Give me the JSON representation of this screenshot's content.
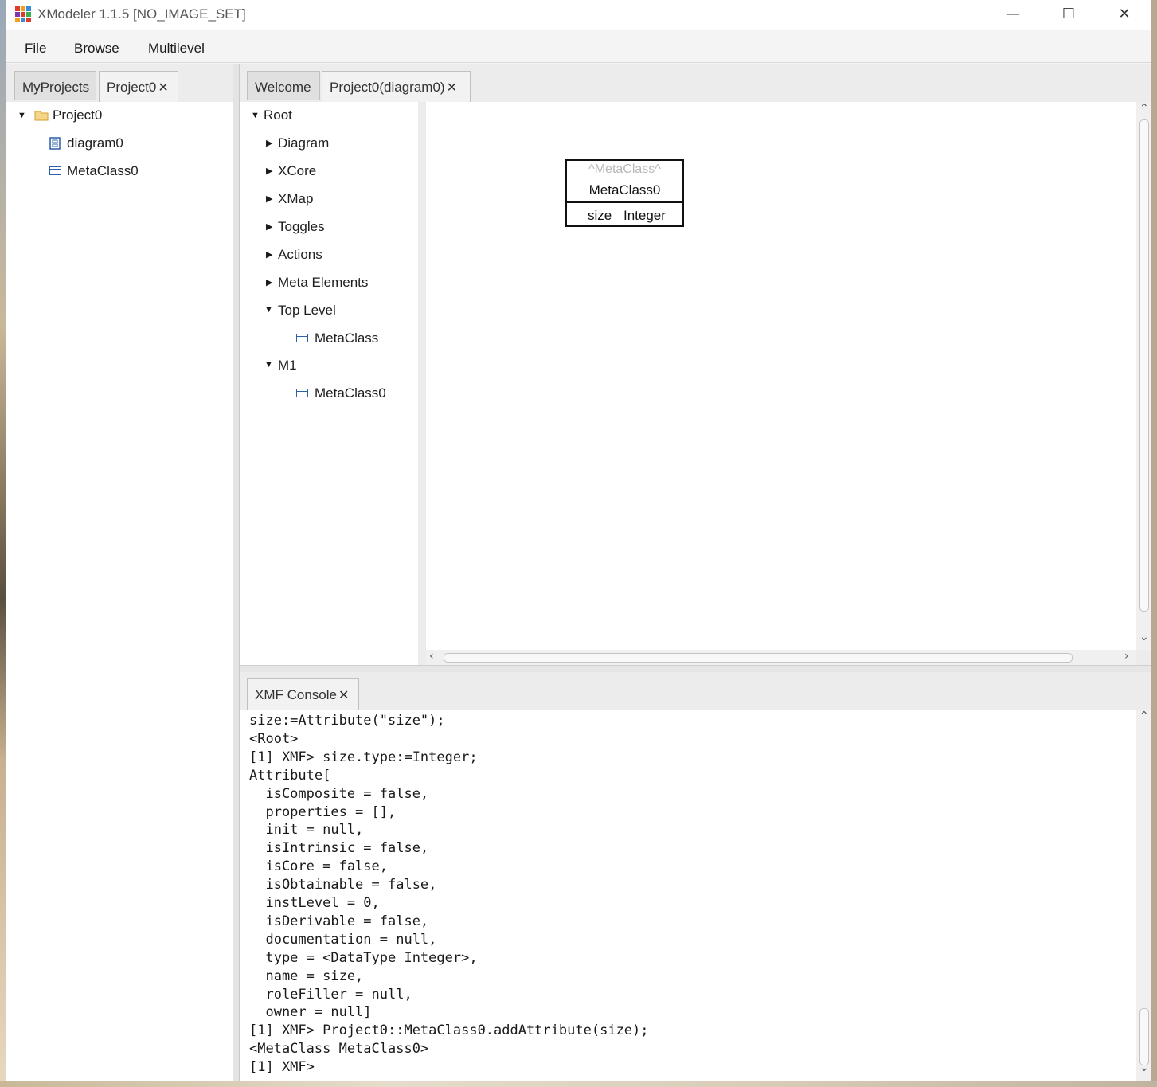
{
  "window": {
    "title": "XModeler 1.1.5 [NO_IMAGE_SET]",
    "icon": "xmodeler-app-icon",
    "controls": {
      "minimize": "—",
      "maximize": "☐",
      "close": "✕"
    }
  },
  "menu": {
    "items": [
      "File",
      "Browse",
      "Multilevel"
    ]
  },
  "left_panel": {
    "tabs": [
      {
        "label": "MyProjects",
        "closable": false
      },
      {
        "label": "Project0",
        "closable": true
      }
    ],
    "tree": {
      "project": "Project0",
      "children": [
        "diagram0",
        "MetaClass0"
      ]
    }
  },
  "editor": {
    "tabs": [
      {
        "label": "Welcome",
        "closable": false
      },
      {
        "label": "Project0(diagram0)",
        "closable": true
      }
    ],
    "browser_tree": {
      "root": "Root",
      "items": [
        "Diagram",
        "XCore",
        "XMap",
        "Toggles",
        "Actions",
        "Meta Elements"
      ],
      "top_level": {
        "label": "Top Level",
        "child": "MetaClass"
      },
      "m1": {
        "label": "M1",
        "child": "MetaClass0"
      }
    },
    "diagram": {
      "class_box": {
        "stereotype": "^MetaClass^",
        "name": "MetaClass0",
        "attribute_name": "size",
        "attribute_type": "Integer"
      }
    }
  },
  "console": {
    "tab_label": "XMF Console",
    "lines": [
      "size:=Attribute(\"size\");",
      "<Root>",
      "[1] XMF> size.type:=Integer;",
      "Attribute[",
      "  isComposite = false,",
      "  properties = [],",
      "  init = null,",
      "  isIntrinsic = false,",
      "  isCore = false,",
      "  isObtainable = false,",
      "  instLevel = 0,",
      "  isDerivable = false,",
      "  documentation = null,",
      "  type = <DataType Integer>,",
      "  name = size,",
      "  roleFiller = null,",
      "  owner = null]",
      "[1] XMF> Project0::MetaClass0.addAttribute(size);",
      "<MetaClass MetaClass0>",
      "[1] XMF> "
    ]
  },
  "colors": {
    "class_icon": "#2f5fa8",
    "folder_icon": "#e8b84a",
    "stereotype_text": "#b8b8b8"
  }
}
